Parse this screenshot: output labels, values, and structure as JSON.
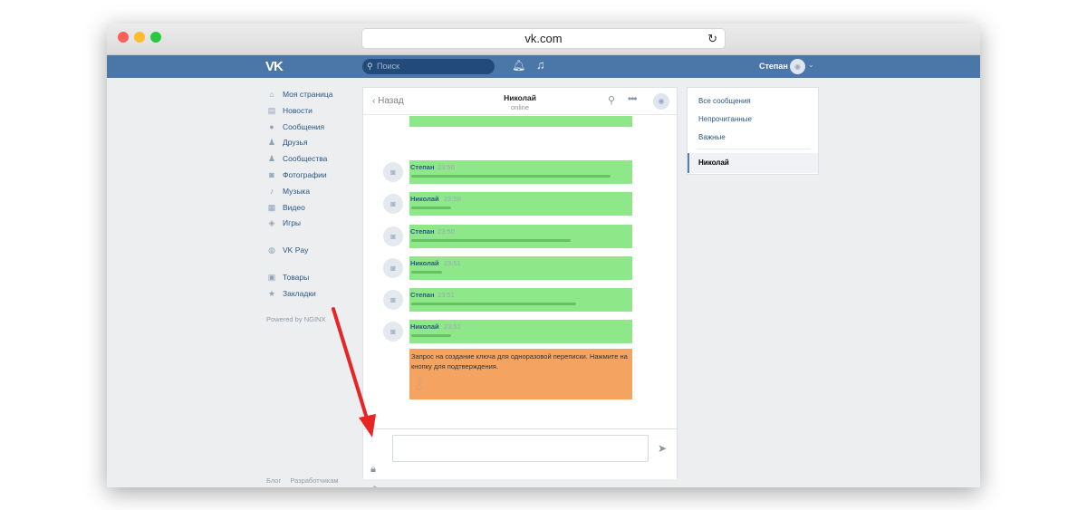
{
  "browser": {
    "url": "vk.com",
    "reload_icon": "reload-icon"
  },
  "header": {
    "logo": "VK",
    "search_placeholder": "Поиск",
    "username": "Степан"
  },
  "nav": {
    "items": [
      {
        "label": "Моя страница",
        "icon": "home-icon"
      },
      {
        "label": "Новости",
        "icon": "news-icon"
      },
      {
        "label": "Сообщения",
        "icon": "messages-icon"
      },
      {
        "label": "Друзья",
        "icon": "friends-icon"
      },
      {
        "label": "Сообщества",
        "icon": "communities-icon"
      },
      {
        "label": "Фотографии",
        "icon": "photos-icon"
      },
      {
        "label": "Музыка",
        "icon": "music-icon"
      },
      {
        "label": "Видео",
        "icon": "video-icon"
      },
      {
        "label": "Игры",
        "icon": "games-icon"
      }
    ],
    "pay": {
      "label": "VK Pay",
      "icon": "vkpay-icon"
    },
    "extra": [
      {
        "label": "Товары",
        "icon": "goods-icon"
      },
      {
        "label": "Закладки",
        "icon": "bookmarks-icon"
      }
    ],
    "powered": "Powered by NGINX",
    "footer": [
      "Блог",
      "Разработчикам"
    ]
  },
  "chat": {
    "back_label": "Назад",
    "peer_name": "Николай",
    "peer_status": "online",
    "messages": [
      {
        "author": "Степан",
        "time": "23:50"
      },
      {
        "author": "Николай",
        "time": "23:50"
      },
      {
        "author": "Степан",
        "time": "23:50"
      },
      {
        "author": "Николай",
        "time": "23:51"
      },
      {
        "author": "Степан",
        "time": "23:51"
      },
      {
        "author": "Николай",
        "time": "23:51"
      }
    ],
    "request_text": "Запрос на создание ключа для одноразовой переписки. Нажмите на кнопку для подтверждения.",
    "input_value": ""
  },
  "right_panel": {
    "items": [
      "Все сообщения",
      "Непрочитанные",
      "Важные"
    ],
    "active": "Николай"
  },
  "colors": {
    "vk_blue": "#4a76a8",
    "message_green": "#8ee88a",
    "request_orange": "#f4a460",
    "arrow_red": "#e82424"
  }
}
